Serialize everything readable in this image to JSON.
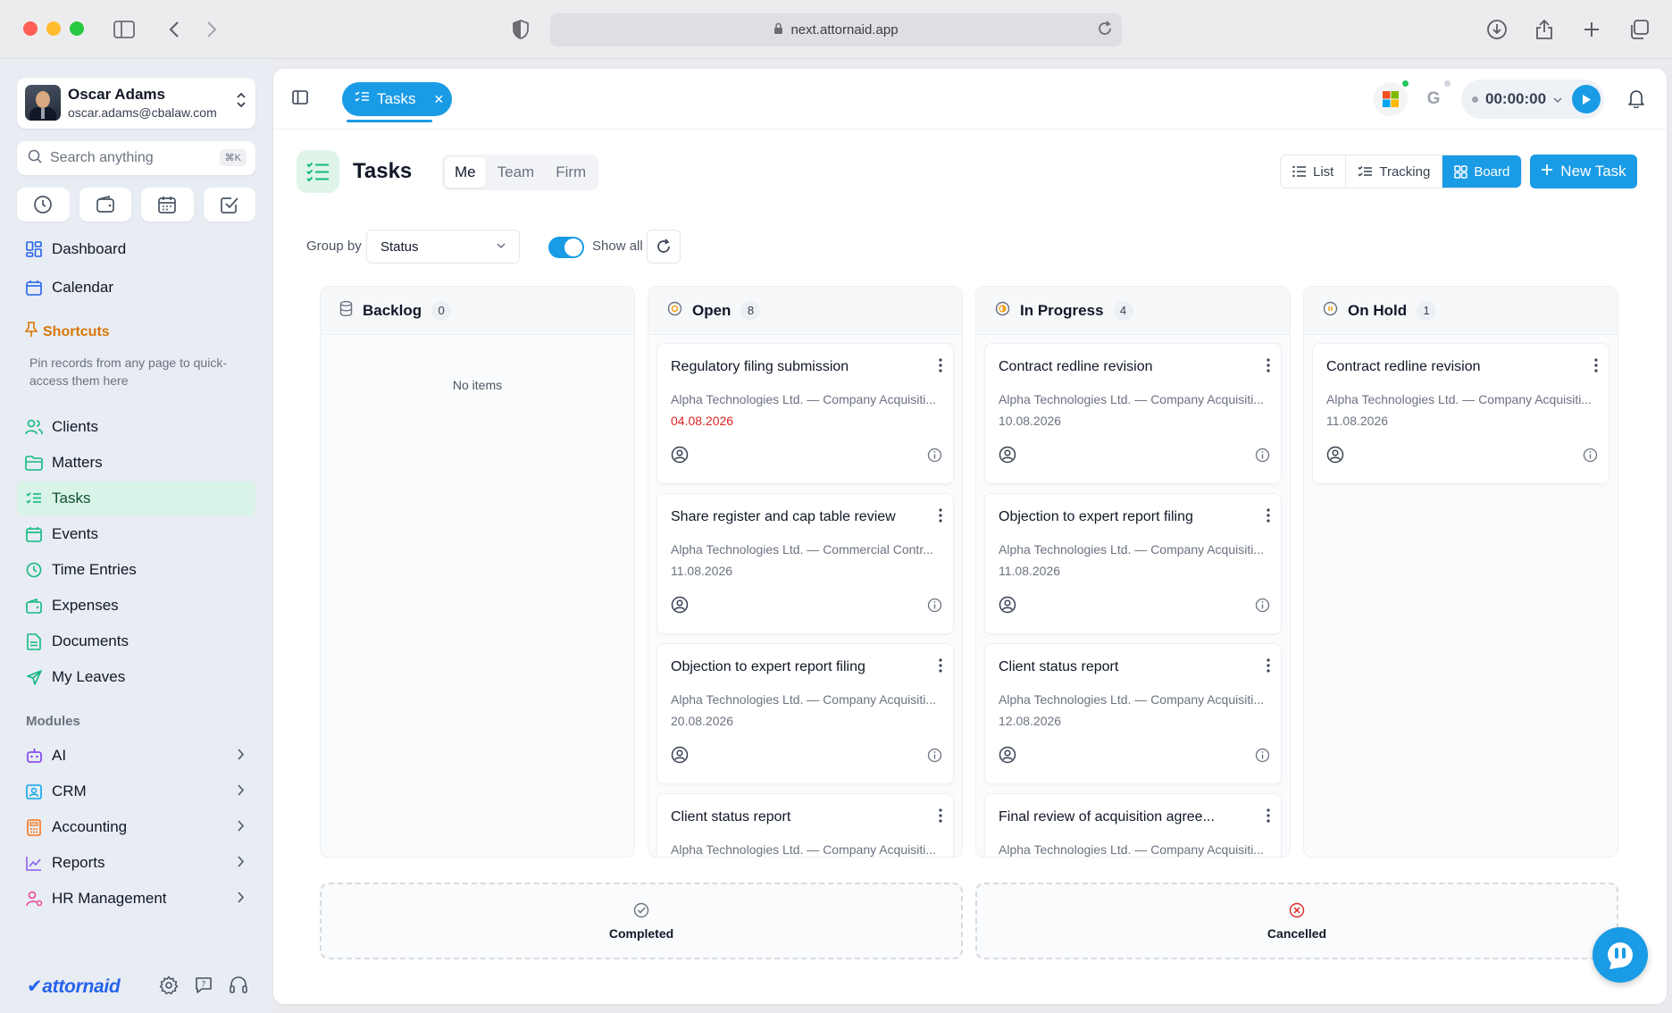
{
  "browser": {
    "url": "next.attornaid.app"
  },
  "user": {
    "name": "Oscar Adams",
    "email": "oscar.adams@cbalaw.com"
  },
  "search": {
    "placeholder": "Search anything",
    "shortcut": "⌘K"
  },
  "sidebar": {
    "top_items": [
      {
        "label": "Dashboard",
        "icon": "dashboard-icon"
      },
      {
        "label": "Calendar",
        "icon": "calendar-icon"
      }
    ],
    "shortcuts_title": "Shortcuts",
    "shortcuts_desc": "Pin records from any page to quick-access them here",
    "items": [
      {
        "label": "Clients",
        "icon": "users-icon"
      },
      {
        "label": "Matters",
        "icon": "folder-icon"
      },
      {
        "label": "Tasks",
        "icon": "tasks-icon",
        "active": true
      },
      {
        "label": "Events",
        "icon": "calendar-event-icon"
      },
      {
        "label": "Time Entries",
        "icon": "clock-icon"
      },
      {
        "label": "Expenses",
        "icon": "wallet-icon"
      },
      {
        "label": "Documents",
        "icon": "document-icon"
      },
      {
        "label": "My Leaves",
        "icon": "plane-icon"
      }
    ],
    "modules_title": "Modules",
    "modules": [
      {
        "label": "AI",
        "icon": "robot-icon"
      },
      {
        "label": "CRM",
        "icon": "contact-card-icon"
      },
      {
        "label": "Accounting",
        "icon": "calculator-icon"
      },
      {
        "label": "Reports",
        "icon": "chart-line-icon"
      },
      {
        "label": "HR Management",
        "icon": "user-gear-icon"
      }
    ],
    "logo": "attornaid"
  },
  "topbar": {
    "tab_label": "Tasks",
    "timer": "00:00:00"
  },
  "page": {
    "title": "Tasks",
    "scope_tabs": [
      "Me",
      "Team",
      "Firm"
    ],
    "scope_selected": "Me",
    "views": [
      "List",
      "Tracking",
      "Board"
    ],
    "view_selected": "Board",
    "new_task": "New Task",
    "group_by_label": "Group by",
    "group_by_value": "Status",
    "show_all_label": "Show all",
    "show_all": true
  },
  "columns": [
    {
      "title": "Backlog",
      "count": "0",
      "empty_text": "No items",
      "cards": []
    },
    {
      "title": "Open",
      "count": "8",
      "cards": [
        {
          "title": "Regulatory filing submission",
          "sub": "Alpha Technologies Ltd. — Company Acquisiti...",
          "date": "04.08.2026",
          "overdue": true
        },
        {
          "title": "Share register and cap table review",
          "sub": "Alpha Technologies Ltd. — Commercial Contr...",
          "date": "11.08.2026"
        },
        {
          "title": "Objection to expert report filing",
          "sub": "Alpha Technologies Ltd. — Company Acquisiti...",
          "date": "20.08.2026"
        },
        {
          "title": "Client status report",
          "sub": "Alpha Technologies Ltd. — Company Acquisiti...",
          "date": ""
        }
      ]
    },
    {
      "title": "In Progress",
      "count": "4",
      "cards": [
        {
          "title": "Contract redline revision",
          "sub": "Alpha Technologies Ltd. — Company Acquisiti...",
          "date": "10.08.2026"
        },
        {
          "title": "Objection to expert report filing",
          "sub": "Alpha Technologies Ltd. — Company Acquisiti...",
          "date": "11.08.2026"
        },
        {
          "title": "Client status report",
          "sub": "Alpha Technologies Ltd. — Company Acquisiti...",
          "date": "12.08.2026"
        },
        {
          "title": "Final review of acquisition agree...",
          "sub": "Alpha Technologies Ltd. — Company Acquisiti...",
          "date": ""
        }
      ]
    },
    {
      "title": "On Hold",
      "count": "1",
      "cards": [
        {
          "title": "Contract redline revision",
          "sub": "Alpha Technologies Ltd. — Company Acquisiti...",
          "date": "11.08.2026"
        }
      ]
    }
  ],
  "drop_zones": [
    {
      "label": "Completed",
      "icon": "check-circle-icon"
    },
    {
      "label": "Cancelled",
      "icon": "x-circle-icon"
    }
  ],
  "colors": {
    "accent": "#1a9be6",
    "active_nav": "#d8f3e7",
    "overdue": "#dc2626",
    "shortcuts": "#d97706"
  }
}
